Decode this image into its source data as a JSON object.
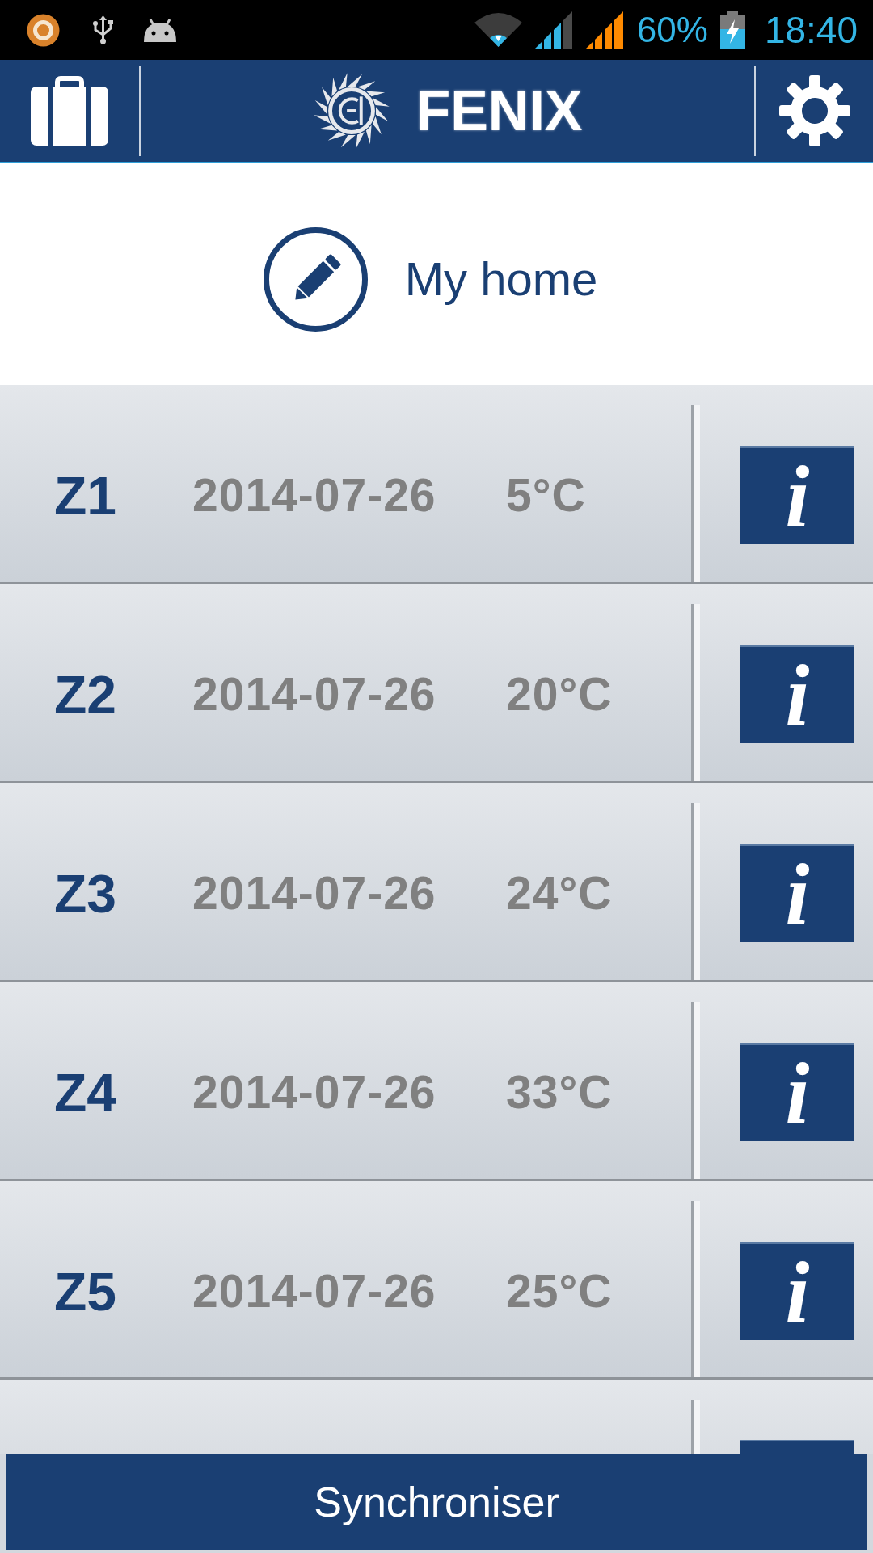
{
  "status_bar": {
    "battery": "60%",
    "time": "18:40"
  },
  "header": {
    "title": "FENIX"
  },
  "home": {
    "name": "My home"
  },
  "zones": [
    {
      "kind": "zone",
      "name": "Z1",
      "date": "2014-07-26",
      "temperature": "5°C",
      "info": "i"
    },
    {
      "kind": "zone",
      "name": "Z2",
      "date": "2014-07-26",
      "temperature": "20°C",
      "info": "i"
    },
    {
      "kind": "zone",
      "name": "Z3",
      "date": "2014-07-26",
      "temperature": "24°C",
      "info": "i"
    },
    {
      "kind": "zone",
      "name": "Z4",
      "date": "2014-07-26",
      "temperature": "33°C",
      "info": "i"
    },
    {
      "kind": "zone",
      "name": "Z5",
      "date": "2014-07-26",
      "temperature": "25°C",
      "info": "i"
    },
    {
      "kind": "partial"
    }
  ],
  "sync_button": {
    "label": "Synchroniser"
  }
}
